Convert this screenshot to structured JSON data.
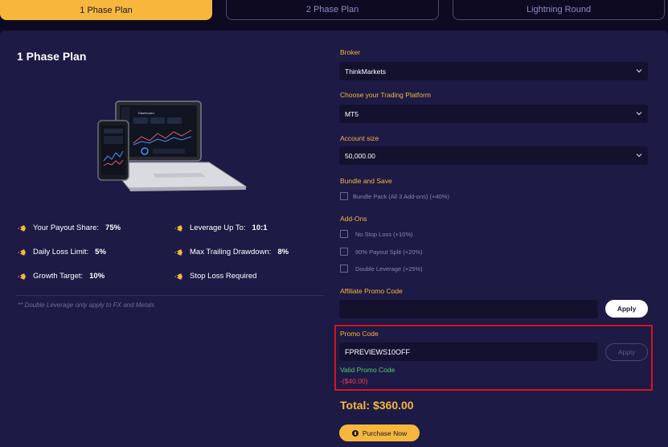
{
  "tabs": [
    {
      "label": "1 Phase Plan",
      "active": true
    },
    {
      "label": "2 Phase Plan",
      "active": false
    },
    {
      "label": "Lightning Round",
      "active": false
    }
  ],
  "plan": {
    "title": "1 Phase Plan",
    "features": [
      {
        "label": "Your Payout Share:",
        "value": "75%"
      },
      {
        "label": "Leverage Up To:",
        "value": "10:1"
      },
      {
        "label": "Daily Loss Limit:",
        "value": "5%"
      },
      {
        "label": "Max Trailing Drawdown:",
        "value": "8%"
      },
      {
        "label": "Growth Target:",
        "value": "10%"
      },
      {
        "label": "Stop Loss Required",
        "value": ""
      }
    ],
    "note": "** Double Leverage only apply to FX and Metals",
    "device_image": {
      "dashboard_title": "Dashboard"
    }
  },
  "form": {
    "broker": {
      "label": "Broker",
      "value": "ThinkMarkets"
    },
    "platform": {
      "label": "Choose your Trading Platform",
      "value": "MT5"
    },
    "account_size": {
      "label": "Account size",
      "value": "50,000.00"
    },
    "bundle": {
      "label": "Bundle and Save",
      "option": "Bundle Pack (All 3 Add-ons) (+40%)"
    },
    "addons": {
      "label": "Add-Ons",
      "options": [
        "No Stop Loss (+10%)",
        "90% Payout Split (+20%)",
        "Double Leverage (+25%)"
      ]
    },
    "affiliate": {
      "label": "Affiliate Promo Code",
      "value": "",
      "apply_label": "Apply"
    },
    "promo": {
      "label": "Promo Code",
      "value": "FPREVIEWS10OFF",
      "apply_label": "Apply",
      "status": "Valid Promo Code",
      "discount": "-($40.00)"
    }
  },
  "total": {
    "text": "Total: $360.00"
  },
  "purchase": {
    "label": "Purchase Now"
  },
  "colors": {
    "accent": "#f6b73c",
    "panel": "#1d1a45",
    "valid": "#4fd16a",
    "error": "#ff3a4c",
    "highlight_border": "#d7141e"
  }
}
